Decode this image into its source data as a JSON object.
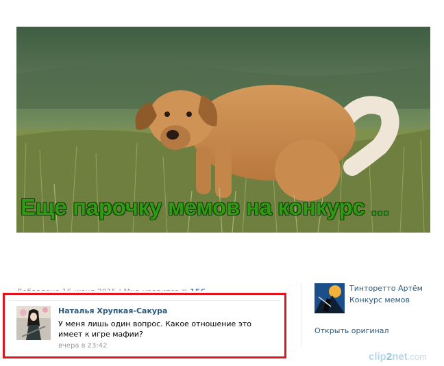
{
  "post": {
    "caption": "Еще парочку мемов на конкурс ...",
    "meta_prefix": "Добавлено 16 июня 2015",
    "meta_sep": "|",
    "meta_like": "Мне нравится",
    "likes_count": "156"
  },
  "comment": {
    "author": "Наталья Хрупкая-Сакура",
    "text": "У меня лишь один вопрос. Какое отношение это имеет к игре мафии?",
    "time": "вчера в 23:42"
  },
  "original": {
    "author": "Тинторетто Артём",
    "group": "Конкурс мемов",
    "open_link": "Открыть оригинал"
  },
  "watermark": {
    "part1": "clip",
    "part2": "2",
    "part3": "net",
    "part4": ".com"
  },
  "colors": {
    "highlight_border": "#e2141b",
    "link": "#2b587a",
    "caption_text": "#2f9a12"
  }
}
